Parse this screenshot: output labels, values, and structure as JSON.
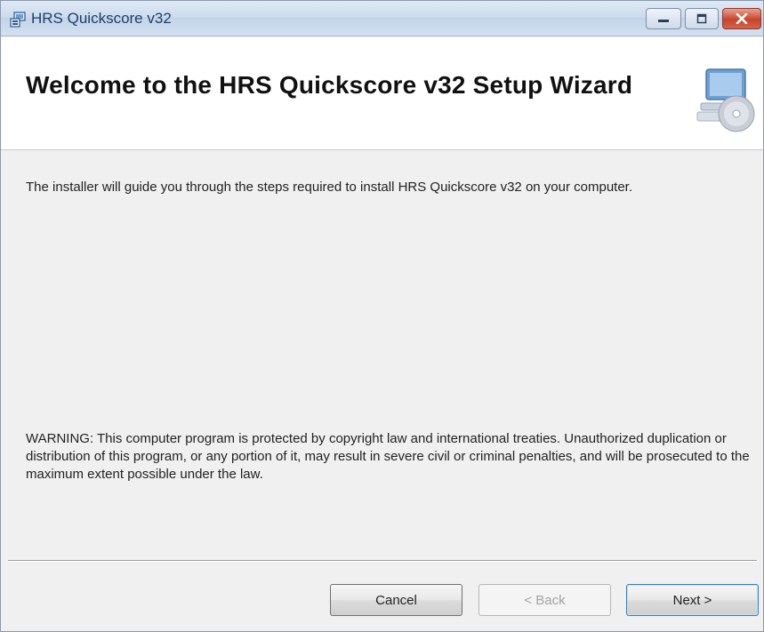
{
  "window": {
    "title": "HRS Quickscore v32"
  },
  "banner": {
    "title": "Welcome to the HRS Quickscore v32 Setup Wizard",
    "art_icon": "computer-cd-icon"
  },
  "body": {
    "intro": "The installer will guide you through the steps required to install HRS Quickscore v32 on your computer.",
    "warning": "WARNING: This computer program is protected by copyright law and international treaties. Unauthorized duplication or distribution of this program, or any portion of it, may result in severe civil or criminal penalties, and will be prosecuted to the maximum extent possible under the law."
  },
  "buttons": {
    "cancel": "Cancel",
    "back": "< Back",
    "next": "Next >"
  },
  "colors": {
    "title_text": "#1e3f66",
    "close_button": "#c9442c",
    "next_focus_border": "#3c7fb1"
  }
}
